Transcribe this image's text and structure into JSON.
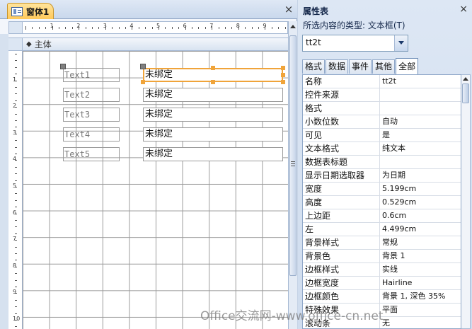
{
  "form_window": {
    "tab_title": "窗体1",
    "close_glyph": "×",
    "section_label": "主体",
    "section_arrow": "◆",
    "labels": [
      "Text1",
      "Text2",
      "Text3",
      "Text4",
      "Text5"
    ],
    "textboxes": [
      "未绑定",
      "未绑定",
      "未绑定",
      "未绑定",
      "未绑定"
    ],
    "ruler_h": [
      "1",
      "2",
      "3",
      "4",
      "5",
      "6",
      "7",
      "8",
      "9"
    ],
    "ruler_v": [
      "1",
      "2",
      "3",
      "4",
      "5",
      "6",
      "7",
      "8",
      "9",
      "10"
    ]
  },
  "property_sheet": {
    "title": "属性表",
    "close_glyph": "×",
    "type_label": "所选内容的类型: 文本框(T)",
    "selected_control": "tt2t",
    "tabs": [
      "格式",
      "数据",
      "事件",
      "其他",
      "全部"
    ],
    "active_tab": "全部",
    "rows": [
      {
        "name": "名称",
        "value": "tt2t"
      },
      {
        "name": "控件来源",
        "value": ""
      },
      {
        "name": "格式",
        "value": ""
      },
      {
        "name": "小数位数",
        "value": "自动"
      },
      {
        "name": "可见",
        "value": "是"
      },
      {
        "name": "文本格式",
        "value": "纯文本"
      },
      {
        "name": "数据表标题",
        "value": ""
      },
      {
        "name": "显示日期选取器",
        "value": "为日期"
      },
      {
        "name": "宽度",
        "value": "5.199cm"
      },
      {
        "name": "高度",
        "value": "0.529cm"
      },
      {
        "name": "上边距",
        "value": "0.6cm"
      },
      {
        "name": "左",
        "value": "4.499cm"
      },
      {
        "name": "背景样式",
        "value": "常规"
      },
      {
        "name": "背景色",
        "value": "背景 1"
      },
      {
        "name": "边框样式",
        "value": "实线"
      },
      {
        "name": "边框宽度",
        "value": "Hairline"
      },
      {
        "name": "边框颜色",
        "value": "背景 1, 深色 35%"
      },
      {
        "name": "特殊效果",
        "value": "平面"
      },
      {
        "name": "滚动条",
        "value": "无"
      }
    ]
  },
  "watermark": "Office交流网-www.office-cn.net",
  "colors": {
    "selection_accent": "#f0a43a",
    "active_tab_bg": "#ffc95a"
  }
}
